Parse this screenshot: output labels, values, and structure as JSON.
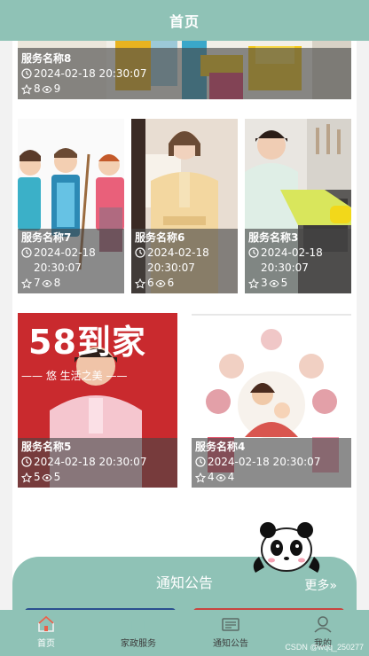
{
  "header": {
    "title": "首页"
  },
  "services": [
    {
      "name": "服务名称8",
      "time": "2024-02-18 20:30:07",
      "likes": "8",
      "views": "9",
      "image_label": "cleaning-tools"
    },
    {
      "name": "服务名称7",
      "time": "2024-02-18 20:30:07",
      "likes": "7",
      "views": "8",
      "image_label": "cleaners-cartoon"
    },
    {
      "name": "服务名称6",
      "time": "2024-02-18 20:30:07",
      "likes": "6",
      "views": "6",
      "image_label": "housekeeper-uniform"
    },
    {
      "name": "服务名称3",
      "time": "2024-02-18 20:30:07",
      "likes": "3",
      "views": "5",
      "image_label": "kitchen-cleaning"
    },
    {
      "name": "服务名称5",
      "time": "2024-02-18 20:30:07",
      "likes": "5",
      "views": "5",
      "image_label": "58-daojia-staff",
      "banner_text": "58到家",
      "banner_sub": "—— 悠   生活之美 ——"
    },
    {
      "name": "服务名称4",
      "time": "2024-02-18 20:30:07",
      "likes": "4",
      "views": "4",
      "image_label": "nanny-collage"
    }
  ],
  "notice": {
    "title": "通知公告",
    "more": "更多»"
  },
  "tabbar": {
    "items": [
      {
        "label": "首页",
        "icon": "home-icon",
        "active": true
      },
      {
        "label": "家政服务",
        "icon": "service-icon",
        "active": false
      },
      {
        "label": "通知公告",
        "icon": "notice-icon",
        "active": false
      },
      {
        "label": "我的",
        "icon": "user-icon",
        "active": false
      }
    ]
  },
  "watermark": "CSDN @wqq_250277",
  "colors": {
    "theme": "#8fc2b6",
    "overlay": "#464646"
  }
}
